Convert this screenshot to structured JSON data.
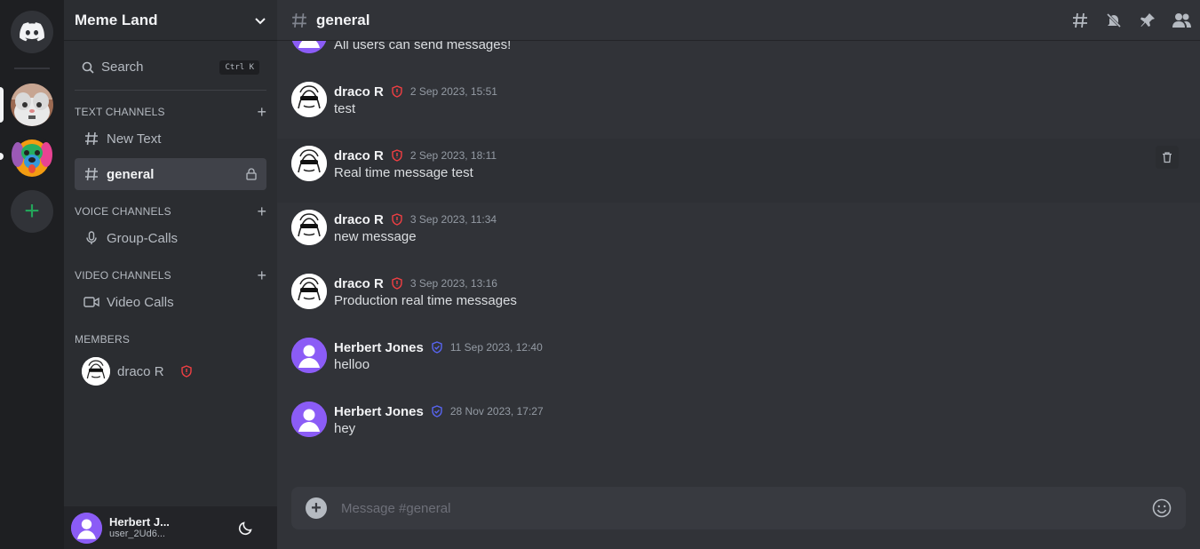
{
  "rail": {
    "home_icon": "discord-logo-icon",
    "servers": [
      {
        "name": "meme-cat-server",
        "active": true
      },
      {
        "name": "rainbow-dog-server",
        "active": false
      }
    ],
    "add_label": "+"
  },
  "sidebar": {
    "server_name": "Meme Land",
    "search_label": "Search",
    "search_shortcut": "Ctrl K",
    "text_section": "TEXT CHANNELS",
    "text_channels": [
      {
        "name": "New Text",
        "active": false
      },
      {
        "name": "general",
        "active": true
      }
    ],
    "voice_section": "VOICE CHANNELS",
    "voice_channels": [
      {
        "name": "Group-Calls"
      }
    ],
    "video_section": "VIDEO CHANNELS",
    "video_channels": [
      {
        "name": "Video Calls"
      }
    ],
    "members_section": "MEMBERS",
    "members": [
      {
        "name": "draco R"
      }
    ]
  },
  "user_panel": {
    "name": "Herbert J...",
    "tag": "user_2Ud6..."
  },
  "header": {
    "channel": "general"
  },
  "messages": [
    {
      "author": "",
      "time": "",
      "text": "All users can send messages!",
      "avatar": "purple",
      "role": "none"
    },
    {
      "author": "draco R",
      "time": "2 Sep 2023, 15:51",
      "text": "test",
      "avatar": "meme",
      "role": "admin"
    },
    {
      "author": "draco R",
      "time": "2 Sep 2023, 18:11",
      "text": "Real time message test",
      "avatar": "meme",
      "role": "admin"
    },
    {
      "author": "draco R",
      "time": "3 Sep 2023, 11:34",
      "text": "new message",
      "avatar": "meme",
      "role": "admin"
    },
    {
      "author": "draco R",
      "time": "3 Sep 2023, 13:16",
      "text": "Production real time messages",
      "avatar": "meme",
      "role": "admin"
    },
    {
      "author": "Herbert Jones",
      "time": "11 Sep 2023, 12:40",
      "text": "helloo",
      "avatar": "purple",
      "role": "moderator"
    },
    {
      "author": "Herbert Jones",
      "time": "28 Nov 2023, 17:27",
      "text": "hey",
      "avatar": "purple",
      "role": "moderator"
    }
  ],
  "composer": {
    "placeholder": "Message #general"
  },
  "colors": {
    "admin_badge": "#f23f43",
    "moderator_badge": "#5865f2",
    "add_server": "#23a55a",
    "accent_purple": "#8b5cf6"
  }
}
